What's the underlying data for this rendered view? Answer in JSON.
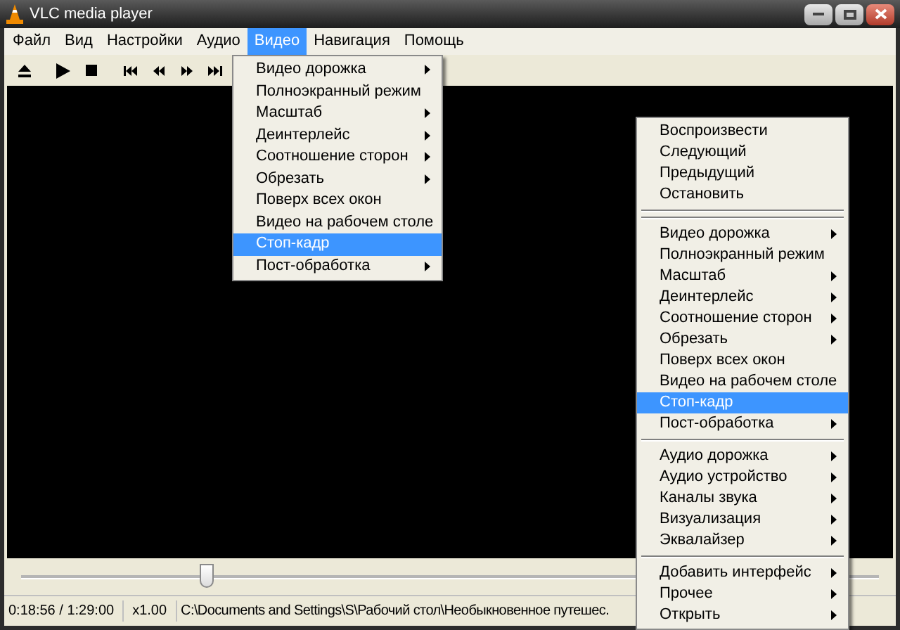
{
  "window": {
    "title": "VLC media player"
  },
  "menubar": [
    {
      "label": "Файл",
      "selected": false
    },
    {
      "label": "Вид",
      "selected": false
    },
    {
      "label": "Настройки",
      "selected": false
    },
    {
      "label": "Аудио",
      "selected": false
    },
    {
      "label": "Видео",
      "selected": true
    },
    {
      "label": "Навигация",
      "selected": false
    },
    {
      "label": "Помощь",
      "selected": false
    }
  ],
  "video_menu": {
    "items": [
      {
        "kind": "item",
        "label": "Видео дорожка",
        "submenu": true,
        "selected": false
      },
      {
        "kind": "item",
        "label": "Полноэкранный режим",
        "submenu": false,
        "selected": false
      },
      {
        "kind": "item",
        "label": "Масштаб",
        "submenu": true,
        "selected": false
      },
      {
        "kind": "item",
        "label": "Деинтерлейс",
        "submenu": true,
        "selected": false
      },
      {
        "kind": "item",
        "label": "Соотношение сторон",
        "submenu": true,
        "selected": false
      },
      {
        "kind": "item",
        "label": "Обрезать",
        "submenu": true,
        "selected": false
      },
      {
        "kind": "item",
        "label": "Поверх всех окон",
        "submenu": false,
        "selected": false
      },
      {
        "kind": "item",
        "label": "Видео на рабочем столе",
        "submenu": false,
        "selected": false
      },
      {
        "kind": "item",
        "label": "Стоп-кадр",
        "submenu": false,
        "selected": true
      },
      {
        "kind": "item",
        "label": "Пост-обработка",
        "submenu": true,
        "selected": false
      }
    ]
  },
  "context_menu": {
    "items": [
      {
        "kind": "item",
        "label": "Воспроизвести",
        "submenu": false,
        "selected": false
      },
      {
        "kind": "item",
        "label": "Следующий",
        "submenu": false,
        "selected": false
      },
      {
        "kind": "item",
        "label": "Предыдущий",
        "submenu": false,
        "selected": false
      },
      {
        "kind": "item",
        "label": "Остановить",
        "submenu": false,
        "selected": false
      },
      {
        "kind": "separator"
      },
      {
        "kind": "separator"
      },
      {
        "kind": "item",
        "label": "Видео дорожка",
        "submenu": true,
        "selected": false
      },
      {
        "kind": "item",
        "label": "Полноэкранный режим",
        "submenu": false,
        "selected": false
      },
      {
        "kind": "item",
        "label": "Масштаб",
        "submenu": true,
        "selected": false
      },
      {
        "kind": "item",
        "label": "Деинтерлейс",
        "submenu": true,
        "selected": false
      },
      {
        "kind": "item",
        "label": "Соотношение сторон",
        "submenu": true,
        "selected": false
      },
      {
        "kind": "item",
        "label": "Обрезать",
        "submenu": true,
        "selected": false
      },
      {
        "kind": "item",
        "label": "Поверх всех окон",
        "submenu": false,
        "selected": false
      },
      {
        "kind": "item",
        "label": "Видео на рабочем столе",
        "submenu": false,
        "selected": false
      },
      {
        "kind": "item",
        "label": "Стоп-кадр",
        "submenu": false,
        "selected": true
      },
      {
        "kind": "item",
        "label": "Пост-обработка",
        "submenu": true,
        "selected": false
      },
      {
        "kind": "separator"
      },
      {
        "kind": "item",
        "label": "Аудио дорожка",
        "submenu": true,
        "selected": false
      },
      {
        "kind": "item",
        "label": "Аудио устройство",
        "submenu": true,
        "selected": false
      },
      {
        "kind": "item",
        "label": "Каналы звука",
        "submenu": true,
        "selected": false
      },
      {
        "kind": "item",
        "label": "Визуализация",
        "submenu": true,
        "selected": false
      },
      {
        "kind": "item",
        "label": "Эквалайзер",
        "submenu": true,
        "selected": false
      },
      {
        "kind": "separator"
      },
      {
        "kind": "item",
        "label": "Добавить интерфейс",
        "submenu": true,
        "selected": false
      },
      {
        "kind": "item",
        "label": "Прочее",
        "submenu": true,
        "selected": false
      },
      {
        "kind": "item",
        "label": "Открыть",
        "submenu": true,
        "selected": false
      }
    ]
  },
  "seek": {
    "level": 0.216
  },
  "status_bar": {
    "time": "0:18:56 / 1:29:00",
    "speed": "x1.00",
    "file": "C:\\Documents and Settings\\S\\Рабочий стол\\Необыкновенное путешес."
  }
}
